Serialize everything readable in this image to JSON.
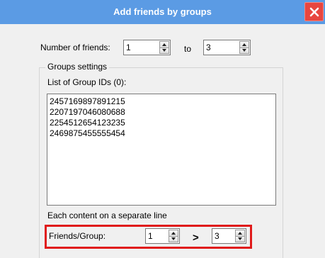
{
  "window": {
    "title": "Add friends by groups",
    "close_icon": "close-icon"
  },
  "friends": {
    "label": "Number of friends:",
    "from_value": "1",
    "to_label": "to",
    "to_value": "3"
  },
  "groups": {
    "legend": "Groups settings",
    "list_label": "List of Group IDs (0):",
    "ids": [
      "2457169897891215",
      "2207197046080688",
      "2254512654123235",
      "2469875455555454"
    ],
    "hint": "Each content on a separate line"
  },
  "per_group": {
    "label": "Friends/Group:",
    "min_value": "1",
    "separator": ">",
    "max_value": "3",
    "highlight_color": "#e01b1b"
  },
  "colors": {
    "titlebar": "#5b9be4",
    "close_button": "#e8463f",
    "background": "#f0f0f0"
  }
}
